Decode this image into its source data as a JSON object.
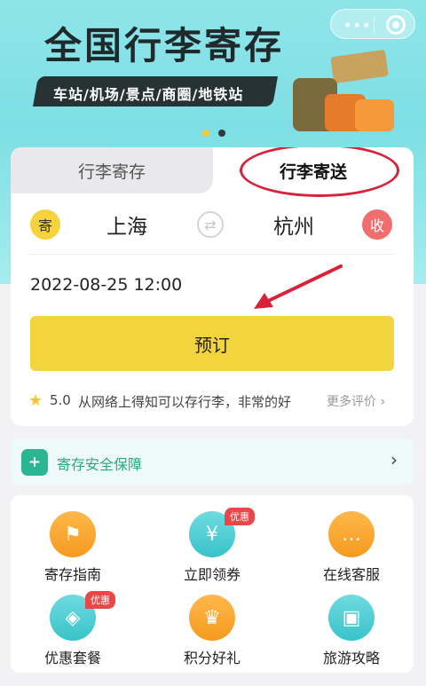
{
  "banner": {
    "title": "全国行李寄存",
    "tagline": "车站/机场/景点/商圈/地铁站",
    "capsule_dots": "•••"
  },
  "tabs": [
    {
      "label": "行李寄存",
      "active": false
    },
    {
      "label": "行李寄送",
      "active": true
    }
  ],
  "route": {
    "send_badge": "寄",
    "from_city": "上海",
    "swap_icon": "⇄",
    "to_city": "杭州",
    "recv_badge": "收"
  },
  "booking": {
    "datetime": "2022-08-25 12:00",
    "button_label": "预订"
  },
  "rating": {
    "score": "5.0",
    "review": "从网络上得知可以存行李，非常的好",
    "more_label": "更多评价 ›"
  },
  "safety": {
    "label": "寄存安全保障",
    "icon_glyph": "+"
  },
  "grid": [
    {
      "label": "寄存指南",
      "icon": "signpost-icon",
      "glyph": "⚑",
      "badge": ""
    },
    {
      "label": "立即领券",
      "icon": "coupon-icon",
      "glyph": "¥",
      "badge": "优惠"
    },
    {
      "label": "在线客服",
      "icon": "chat-icon",
      "glyph": "…",
      "badge": ""
    },
    {
      "label": "优惠套餐",
      "icon": "tag-icon",
      "glyph": "◈",
      "badge": "优惠"
    },
    {
      "label": "积分好礼",
      "icon": "crown-icon",
      "glyph": "♛",
      "badge": ""
    },
    {
      "label": "旅游攻略",
      "icon": "guidebook-icon",
      "glyph": "▣",
      "badge": ""
    }
  ],
  "colors": {
    "accent_yellow": "#f2d43c",
    "annotation_red": "#d8223a",
    "safety_green": "#28a886"
  }
}
